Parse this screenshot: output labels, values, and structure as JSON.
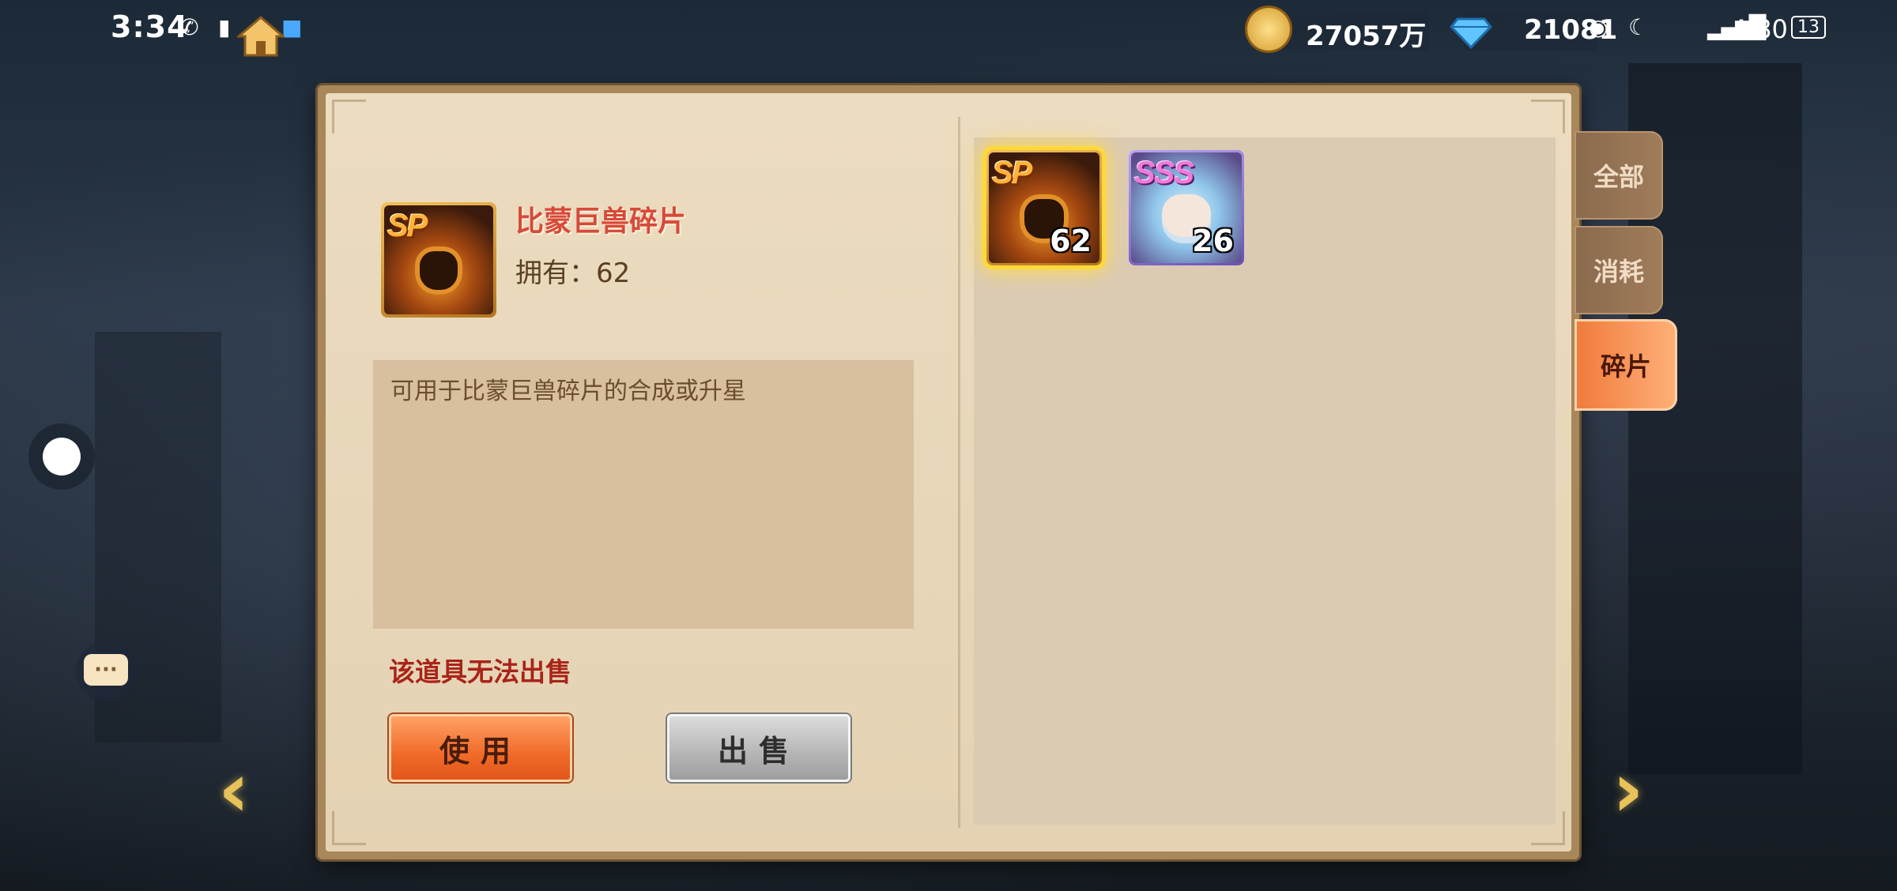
{
  "status": {
    "time": "3:34",
    "right_text": "4/80",
    "battery": "13"
  },
  "currency": {
    "gold": "27057万",
    "diamond": "21081"
  },
  "item": {
    "name": "比蒙巨兽碎片",
    "owned": "拥有：62",
    "rank": "SP",
    "description": "可用于比蒙巨兽碎片的合成或升星",
    "warning": "该道具无法出售"
  },
  "buttons": {
    "use": "使用",
    "sell": "出售"
  },
  "inventory": [
    {
      "rank": "SP",
      "count": "62",
      "selected": true
    },
    {
      "rank": "SSS",
      "count": "26",
      "selected": false
    }
  ],
  "tabs": [
    {
      "label": "全部",
      "active": false
    },
    {
      "label": "消耗",
      "active": false
    },
    {
      "label": "碎片",
      "active": true
    }
  ],
  "icons": {
    "home": "home-icon",
    "gold": "gold-coin-icon",
    "diamond": "diamond-icon",
    "chat": "chat-icon",
    "prev": "arrow-left-icon",
    "next": "arrow-right-icon"
  },
  "colors": {
    "accent": "#f06a28",
    "warning": "#a92418",
    "item_name": "#d64a3a",
    "selected_glow": "#ffd93a"
  }
}
